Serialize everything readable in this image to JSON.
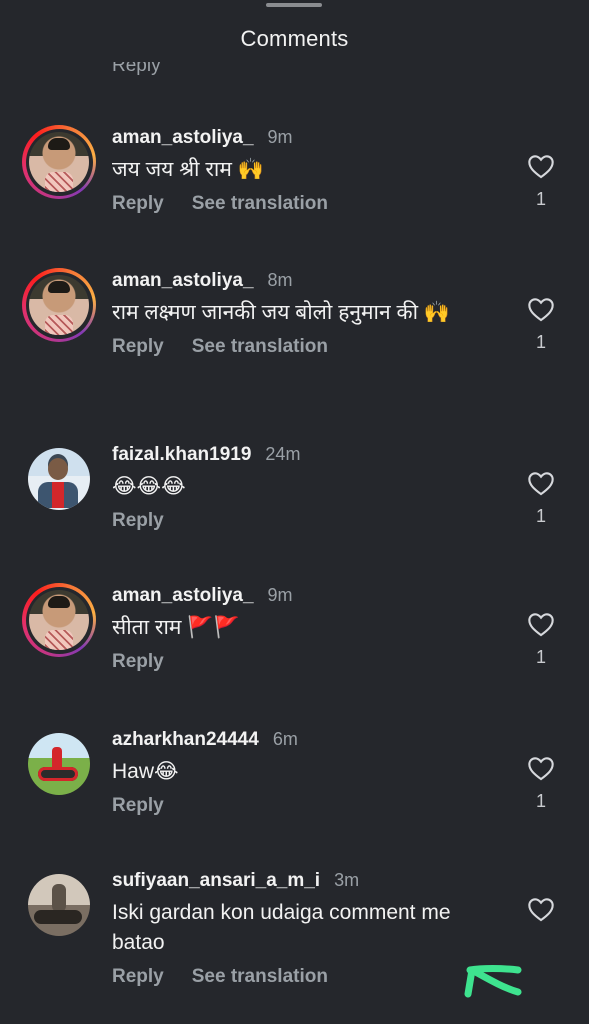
{
  "header": {
    "title": "Comments"
  },
  "partial_reply_label": "Reply",
  "comments": [
    {
      "username": "aman_astoliya_",
      "time": "9m",
      "text": "जय जय श्री राम 🙌",
      "actions": [
        "Reply",
        "See translation"
      ],
      "likes": "1",
      "avatar": "aman"
    },
    {
      "username": "aman_astoliya_",
      "time": "8m",
      "text": "राम लक्ष्मण जानकी जय बोलो हनुमान की 🙌",
      "actions": [
        "Reply",
        "See translation"
      ],
      "likes": "1",
      "avatar": "aman"
    },
    {
      "username": "faizal.khan1919",
      "time": "24m",
      "text": "😂😂😂",
      "actions": [
        "Reply"
      ],
      "likes": "1",
      "avatar": "faizal"
    },
    {
      "username": "aman_astoliya_",
      "time": "9m",
      "text": "सीता राम 🚩🚩",
      "actions": [
        "Reply"
      ],
      "likes": "1",
      "avatar": "aman"
    },
    {
      "username": "azharkhan24444",
      "time": "6m",
      "text": "Haw😂",
      "actions": [
        "Reply"
      ],
      "likes": "1",
      "avatar": "azhar"
    },
    {
      "username": "sufiyaan_ansari_a_m_i",
      "time": "3m",
      "text": "Iski gardan kon udaiga comment me batao",
      "actions": [
        "Reply",
        "See translation"
      ],
      "likes": "",
      "avatar": "sufi"
    }
  ],
  "colors": {
    "background": "#25272c",
    "text": "#f2f2f2",
    "muted": "#9aa0a6",
    "annotation_arrow": "#3ee38f"
  },
  "icons": {
    "like": "heart-outline-icon",
    "annotation": "hand-drawn-arrow-icon"
  }
}
